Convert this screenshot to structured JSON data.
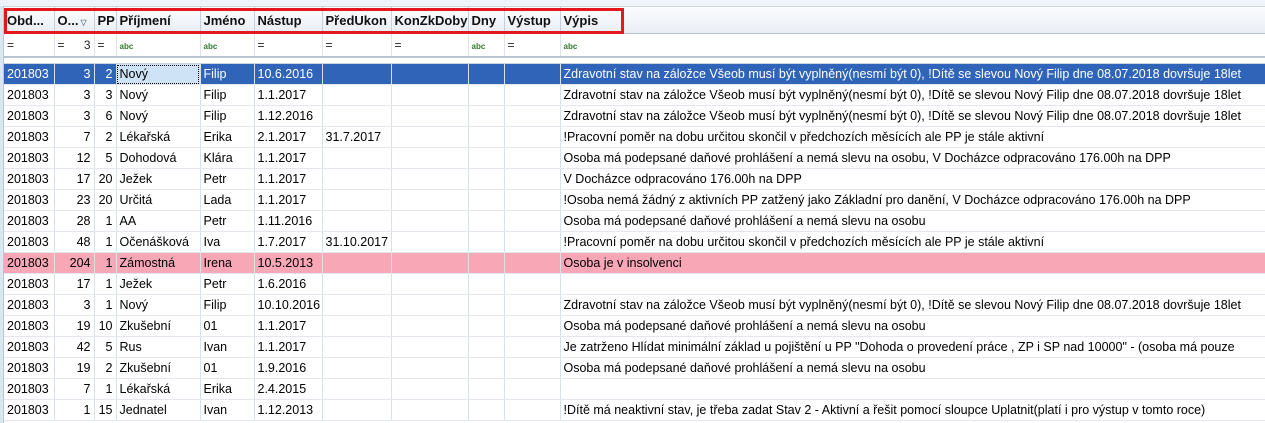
{
  "columns": [
    "Obd...",
    "O...",
    "PP",
    "Příjmení",
    "Jméno",
    "Nástup",
    "PředUkon",
    "KonZkDoby",
    "Dny",
    "Výstup",
    "Výpis"
  ],
  "filter_row": [
    "=",
    "=",
    "3",
    "=",
    "abc",
    "abc",
    "=",
    "=",
    "=",
    "abc",
    "=",
    "abc"
  ],
  "rows": [
    {
      "obd": "201803",
      "o": "3",
      "pp": "2",
      "prijmeni": "Nový",
      "jmeno": "Filip",
      "nastup": "10.6.2016",
      "predukon": "",
      "konzk": "",
      "dny": "",
      "vystup": "",
      "vypis": "Zdravotní stav na záložce Všeob musí být vyplněný(nesmí být 0), !Dítě se slevou Nový Filip dne 08.07.2018 dovršuje 18let"
    },
    {
      "obd": "201803",
      "o": "3",
      "pp": "3",
      "prijmeni": "Nový",
      "jmeno": "Filip",
      "nastup": "1.1.2017",
      "predukon": "",
      "konzk": "",
      "dny": "",
      "vystup": "",
      "vypis": "Zdravotní stav na záložce Všeob musí být vyplněný(nesmí být 0), !Dítě se slevou Nový Filip dne 08.07.2018 dovršuje 18let"
    },
    {
      "obd": "201803",
      "o": "3",
      "pp": "6",
      "prijmeni": "Nový",
      "jmeno": "Filip",
      "nastup": "1.12.2016",
      "predukon": "",
      "konzk": "",
      "dny": "",
      "vystup": "",
      "vypis": "Zdravotní stav na záložce Všeob musí být vyplněný(nesmí být 0), !Dítě se slevou Nový Filip dne 08.07.2018 dovršuje 18let"
    },
    {
      "obd": "201803",
      "o": "7",
      "pp": "2",
      "prijmeni": "Lékařská",
      "jmeno": "Erika",
      "nastup": "2.1.2017",
      "predukon": "31.7.2017",
      "konzk": "",
      "dny": "",
      "vystup": "",
      "vypis": "!Pracovní poměr na dobu určitou skončil v předchozích měsících ale PP je stále aktivní"
    },
    {
      "obd": "201803",
      "o": "12",
      "pp": "5",
      "prijmeni": "Dohodová",
      "jmeno": "Klára",
      "nastup": "1.1.2017",
      "predukon": "",
      "konzk": "",
      "dny": "",
      "vystup": "",
      "vypis": "Osoba má podepsané daňové prohlášení a nemá slevu na osobu, V Docházce odpracováno 176.00h na DPP"
    },
    {
      "obd": "201803",
      "o": "17",
      "pp": "20",
      "prijmeni": "Ježek",
      "jmeno": "Petr",
      "nastup": "1.1.2017",
      "predukon": "",
      "konzk": "",
      "dny": "",
      "vystup": "",
      "vypis": "V Docházce odpracováno 176.00h na DPP"
    },
    {
      "obd": "201803",
      "o": "23",
      "pp": "20",
      "prijmeni": "Určitá",
      "jmeno": "Lada",
      "nastup": "1.1.2017",
      "predukon": "",
      "konzk": "",
      "dny": "",
      "vystup": "",
      "vypis": "!Osoba nemá žádný z aktivních PP zatžený jako Základní pro danění, V Docházce odpracováno 176.00h na DPP"
    },
    {
      "obd": "201803",
      "o": "28",
      "pp": "1",
      "prijmeni": "AA",
      "jmeno": "Petr",
      "nastup": "1.11.2016",
      "predukon": "",
      "konzk": "",
      "dny": "",
      "vystup": "",
      "vypis": "Osoba má podepsané daňové prohlášení a nemá slevu na osobu"
    },
    {
      "obd": "201803",
      "o": "48",
      "pp": "1",
      "prijmeni": "Očenášková",
      "jmeno": "Iva",
      "nastup": "1.7.2017",
      "predukon": "31.10.2017",
      "konzk": "",
      "dny": "",
      "vystup": "",
      "vypis": "!Pracovní poměr na dobu určitou skončil v předchozích měsících ale PP je stále aktivní"
    },
    {
      "obd": "201803",
      "o": "204",
      "pp": "1",
      "prijmeni": "Zámostná",
      "jmeno": "Irena",
      "nastup": "10.5.2013",
      "predukon": "",
      "konzk": "",
      "dny": "",
      "vystup": "",
      "vypis": "Osoba je v insolvenci"
    },
    {
      "obd": "201803",
      "o": "17",
      "pp": "1",
      "prijmeni": "Ježek",
      "jmeno": "Petr",
      "nastup": "1.6.2016",
      "predukon": "",
      "konzk": "",
      "dny": "",
      "vystup": "",
      "vypis": ""
    },
    {
      "obd": "201803",
      "o": "3",
      "pp": "1",
      "prijmeni": "Nový",
      "jmeno": "Filip",
      "nastup": "10.10.2016",
      "predukon": "",
      "konzk": "",
      "dny": "",
      "vystup": "",
      "vypis": "Zdravotní stav na záložce Všeob musí být vyplněný(nesmí být 0), !Dítě se slevou Nový Filip dne 08.07.2018 dovršuje 18let"
    },
    {
      "obd": "201803",
      "o": "19",
      "pp": "10",
      "prijmeni": "Zkušební",
      "jmeno": "01",
      "nastup": "1.1.2017",
      "predukon": "",
      "konzk": "",
      "dny": "",
      "vystup": "",
      "vypis": "Osoba má podepsané daňové prohlášení a nemá slevu na osobu"
    },
    {
      "obd": "201803",
      "o": "42",
      "pp": "5",
      "prijmeni": "Rus",
      "jmeno": "Ivan",
      "nastup": "1.1.2017",
      "predukon": "",
      "konzk": "",
      "dny": "",
      "vystup": "",
      "vypis": "Je zatrženo Hlídat minimální základ u pojištění u PP \"Dohoda o provedení práce , ZP i SP nad 10000\" - (osoba má pouze"
    },
    {
      "obd": "201803",
      "o": "19",
      "pp": "2",
      "prijmeni": "Zkušební",
      "jmeno": "01",
      "nastup": "1.9.2016",
      "predukon": "",
      "konzk": "",
      "dny": "",
      "vystup": "",
      "vypis": "Osoba má podepsané daňové prohlášení a nemá slevu na osobu"
    },
    {
      "obd": "201803",
      "o": "7",
      "pp": "1",
      "prijmeni": "Lékařská",
      "jmeno": "Erika",
      "nastup": "2.4.2015",
      "predukon": "",
      "konzk": "",
      "dny": "",
      "vystup": "",
      "vypis": ""
    },
    {
      "obd": "201803",
      "o": "1",
      "pp": "15",
      "prijmeni": "Jednatel",
      "jmeno": "Ivan",
      "nastup": "1.12.2013",
      "predukon": "",
      "konzk": "",
      "dny": "",
      "vystup": "",
      "vypis": "!Dítě má neaktivní stav, je třeba zadat Stav 2 - Aktivní a řešit pomocí sloupce Uplatnit(platí i pro výstup v tomto roce)"
    }
  ],
  "row_states": {
    "selected_index": 0,
    "highlight_index": 9
  },
  "colors": {
    "selected": "#2f64b9",
    "highlight": "#f7a7b5",
    "annotation_box": "#e1191f"
  }
}
